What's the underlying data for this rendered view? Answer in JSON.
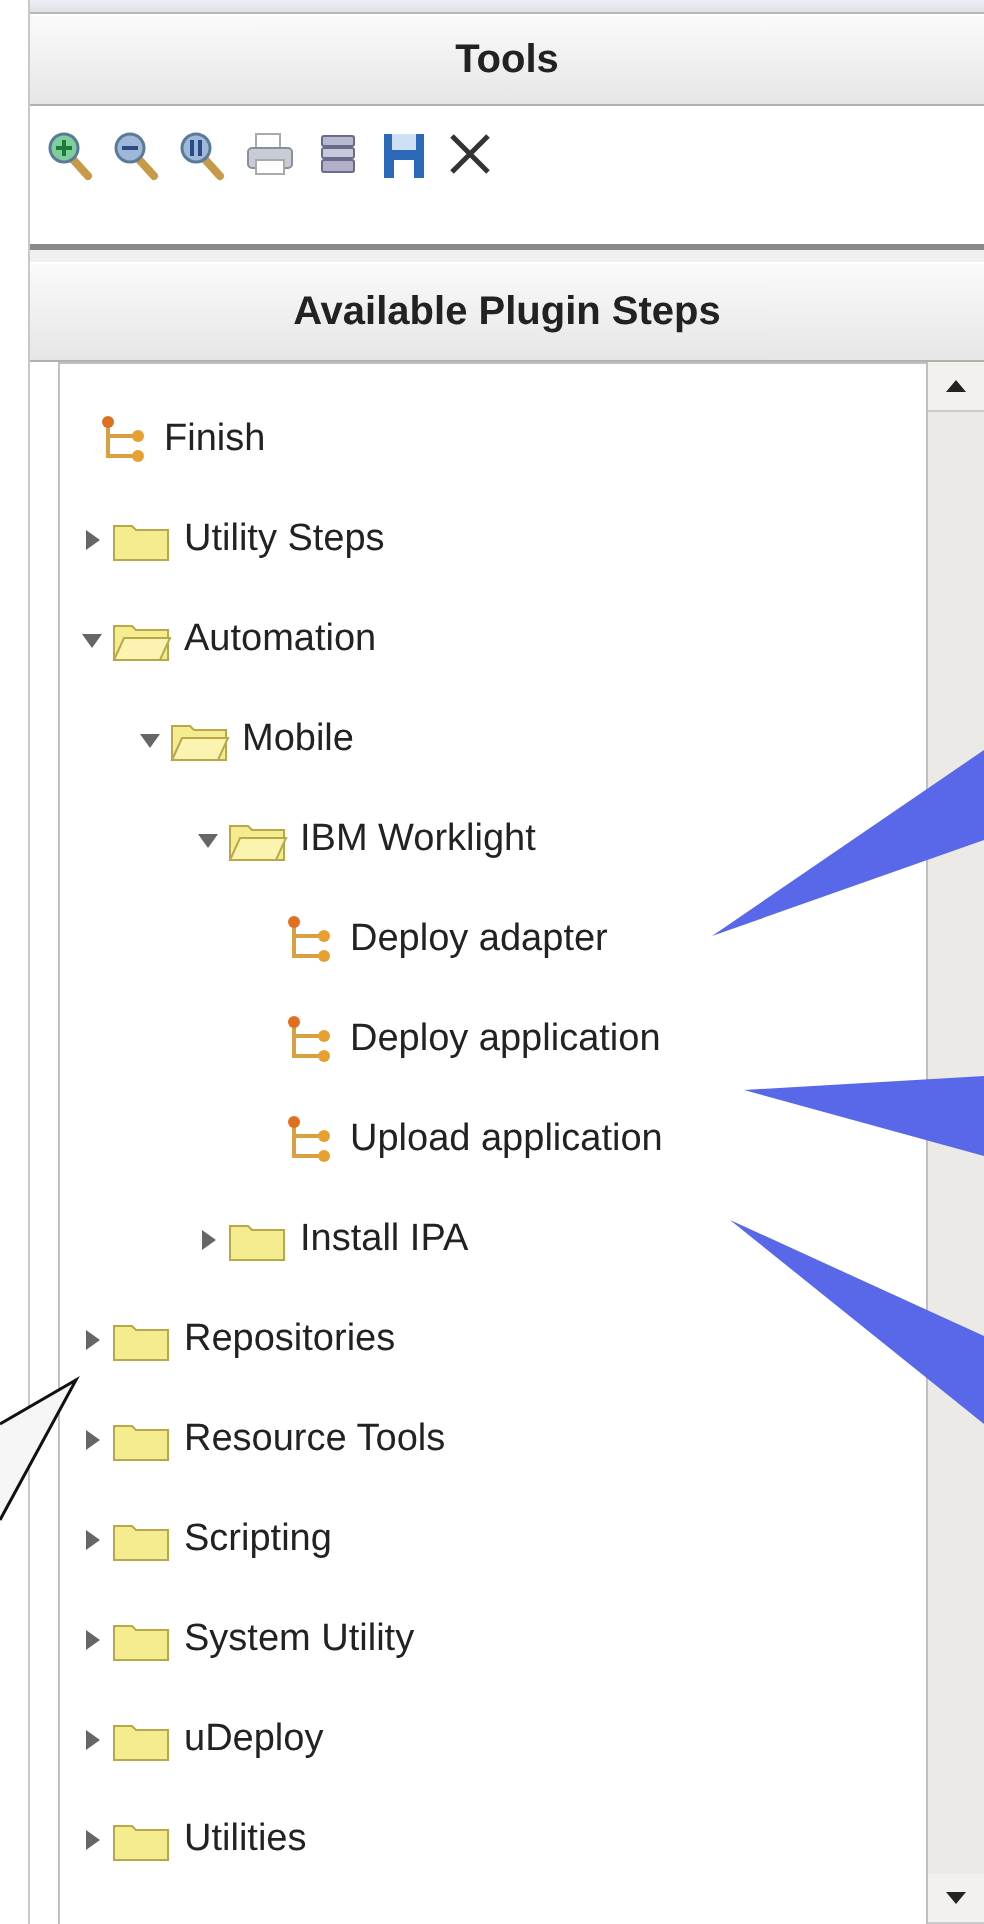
{
  "tools_panel": {
    "title": "Tools"
  },
  "plugin_panel": {
    "title": "Available Plugin Steps",
    "tree": [
      {
        "kind": "step",
        "label": "Finish"
      },
      {
        "kind": "folder",
        "label": "Utility Steps",
        "expanded": false
      },
      {
        "kind": "folder",
        "label": "Automation",
        "expanded": true,
        "children": [
          {
            "kind": "folder",
            "label": "Mobile",
            "expanded": true,
            "children": [
              {
                "kind": "folder",
                "label": "IBM Worklight",
                "expanded": true,
                "children": [
                  {
                    "kind": "step",
                    "label": "Deploy adapter"
                  },
                  {
                    "kind": "step",
                    "label": "Deploy application"
                  },
                  {
                    "kind": "step",
                    "label": "Upload application"
                  }
                ]
              },
              {
                "kind": "folder",
                "label": "Install IPA",
                "expanded": false
              }
            ]
          }
        ]
      },
      {
        "kind": "folder",
        "label": "Repositories",
        "expanded": false
      },
      {
        "kind": "folder",
        "label": "Resource Tools",
        "expanded": false
      },
      {
        "kind": "folder",
        "label": "Scripting",
        "expanded": false
      },
      {
        "kind": "folder",
        "label": "System Utility",
        "expanded": false
      },
      {
        "kind": "folder",
        "label": "uDeploy",
        "expanded": false
      },
      {
        "kind": "folder",
        "label": "Utilities",
        "expanded": false
      }
    ]
  }
}
